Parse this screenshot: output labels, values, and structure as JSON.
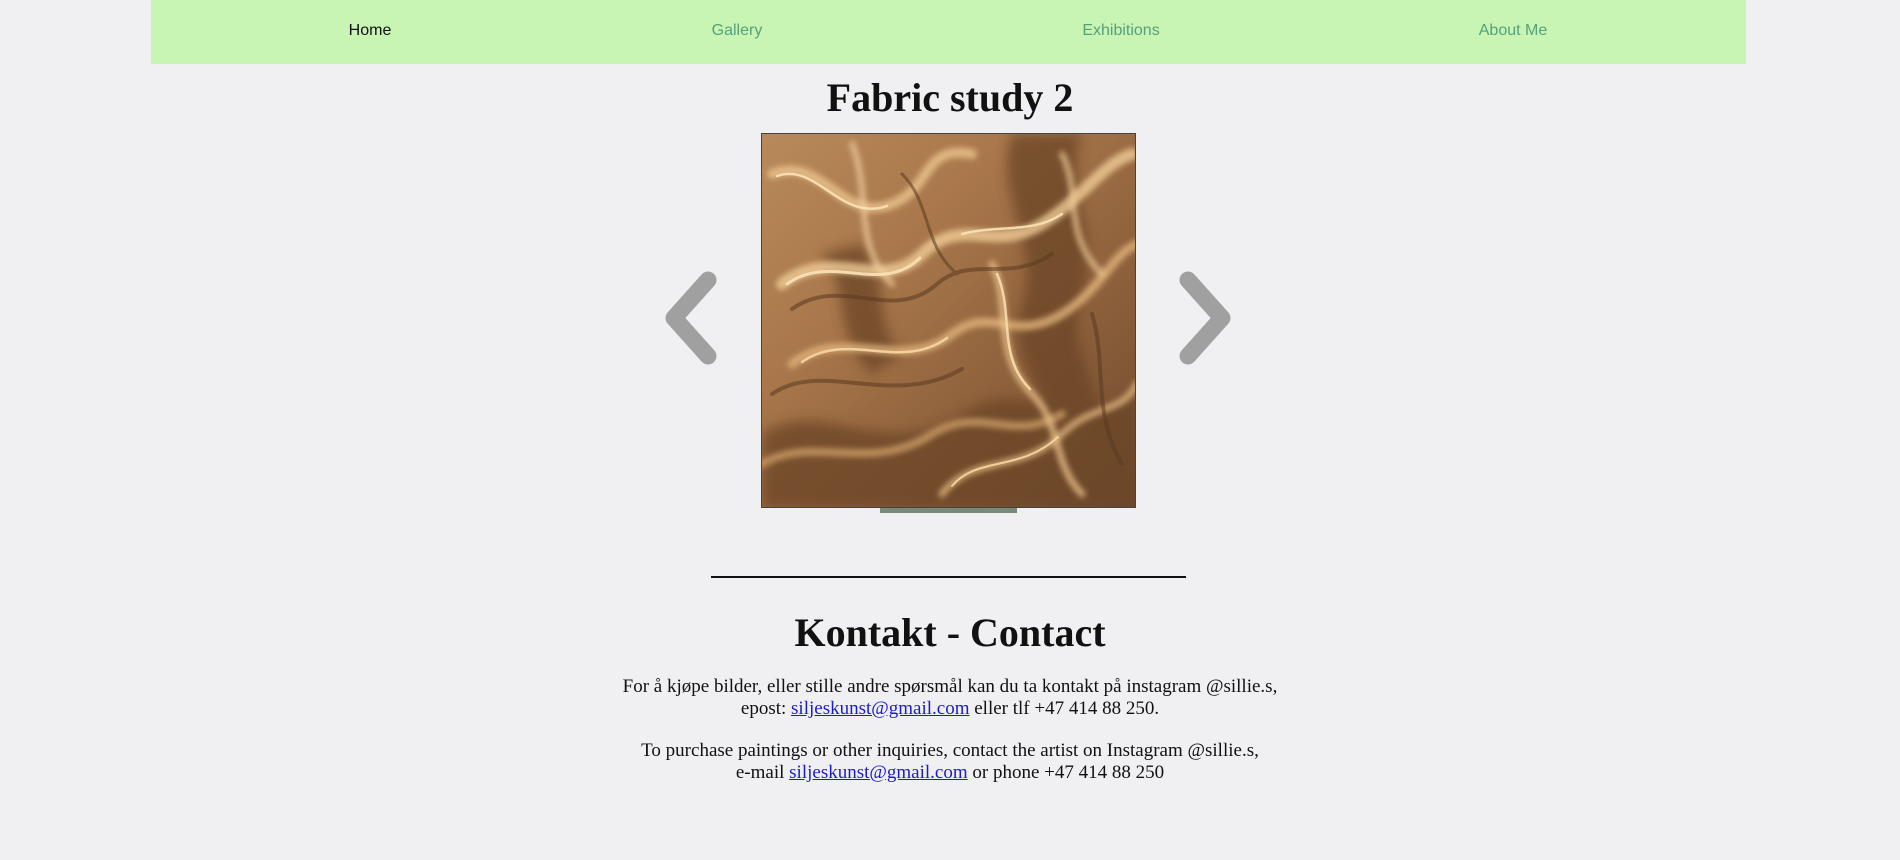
{
  "nav": {
    "items": [
      {
        "label": "Home",
        "active": true
      },
      {
        "label": "Gallery",
        "active": false
      },
      {
        "label": "Exhibitions",
        "active": false
      },
      {
        "label": "About Me",
        "active": false
      }
    ]
  },
  "gallery": {
    "title": "Fabric study 2",
    "prev_icon": "chevron-left-icon",
    "next_icon": "chevron-right-icon"
  },
  "contact": {
    "heading": "Kontakt - Contact",
    "norwegian": {
      "line1": "For å kjøpe bilder, eller stille andre spørsmål kan du ta kontakt på instagram @sillie.s,",
      "email_prefix": "epost: ",
      "email": "siljeskunst@gmail.com",
      "phone_text": " eller tlf  +47 414 88 250."
    },
    "english": {
      "line1": "To purchase paintings or other inquiries, contact the artist on Instagram @sillie.s,",
      "email_prefix": "e-mail ",
      "email": "siljeskunst@gmail.com",
      "phone_text": " or phone +47 414 88 250"
    }
  },
  "colors": {
    "page_background": "#f0eff2",
    "navbar_background": "#c8f4b4",
    "nav_link": "#58a07a",
    "nav_link_active": "#111111",
    "arrow": "#a0a0a0",
    "link": "#1b1bcc"
  }
}
